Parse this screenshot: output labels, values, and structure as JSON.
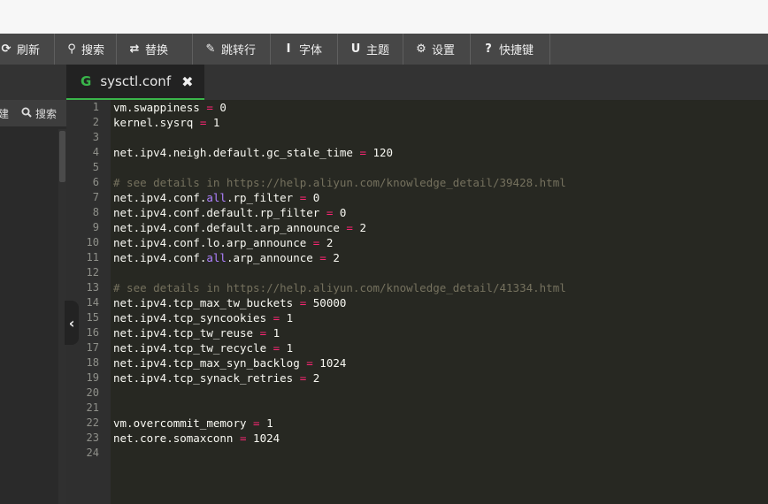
{
  "toolbar": {
    "items": [
      {
        "icon": "refresh-icon",
        "glyph": "⟳",
        "label": "刷新"
      },
      {
        "icon": "search-icon",
        "glyph": "⚲",
        "label": "搜索"
      },
      {
        "icon": "replace-icon",
        "glyph": "⇄",
        "label": "替换"
      },
      {
        "icon": "pin-icon",
        "glyph": "✎",
        "label": "跳转行"
      },
      {
        "icon": "font-icon",
        "glyph": "I",
        "label": "字体"
      },
      {
        "icon": "magnet-icon",
        "glyph": "U",
        "label": "主题"
      },
      {
        "icon": "gear-icon",
        "glyph": "⚙",
        "label": "设置"
      },
      {
        "icon": "help-icon",
        "glyph": "?",
        "label": "快捷键"
      }
    ]
  },
  "sidebar": {
    "partial_label": "建",
    "search_label": "搜索",
    "collapse_glyph": "‹"
  },
  "tab": {
    "icon": "G",
    "filename": "sysctl.conf",
    "close_glyph": "✖"
  },
  "editor": {
    "lines": [
      {
        "n": "1",
        "tokens": [
          {
            "t": "vm.swappiness ",
            "c": ""
          },
          {
            "t": "=",
            "c": "op"
          },
          {
            "t": " 0",
            "c": ""
          }
        ]
      },
      {
        "n": "2",
        "tokens": [
          {
            "t": "kernel.sysrq ",
            "c": ""
          },
          {
            "t": "=",
            "c": "op"
          },
          {
            "t": " 1",
            "c": ""
          }
        ]
      },
      {
        "n": "3",
        "tokens": []
      },
      {
        "n": "4",
        "tokens": [
          {
            "t": "net.ipv4.neigh.default.gc_stale_time ",
            "c": ""
          },
          {
            "t": "=",
            "c": "op"
          },
          {
            "t": " 120",
            "c": ""
          }
        ]
      },
      {
        "n": "5",
        "tokens": []
      },
      {
        "n": "6",
        "tokens": [
          {
            "t": "# see details in https://help.aliyun.com/knowledge_detail/39428.html",
            "c": "cmt"
          }
        ]
      },
      {
        "n": "7",
        "tokens": [
          {
            "t": "net.ipv4.conf.",
            "c": ""
          },
          {
            "t": "all",
            "c": "kw"
          },
          {
            "t": ".rp_filter ",
            "c": ""
          },
          {
            "t": "=",
            "c": "op"
          },
          {
            "t": " 0",
            "c": ""
          }
        ]
      },
      {
        "n": "8",
        "tokens": [
          {
            "t": "net.ipv4.conf.default.rp_filter ",
            "c": ""
          },
          {
            "t": "=",
            "c": "op"
          },
          {
            "t": " 0",
            "c": ""
          }
        ]
      },
      {
        "n": "9",
        "tokens": [
          {
            "t": "net.ipv4.conf.default.arp_announce ",
            "c": ""
          },
          {
            "t": "=",
            "c": "op"
          },
          {
            "t": " 2",
            "c": ""
          }
        ]
      },
      {
        "n": "10",
        "tokens": [
          {
            "t": "net.ipv4.conf.lo.arp_announce ",
            "c": ""
          },
          {
            "t": "=",
            "c": "op"
          },
          {
            "t": " 2",
            "c": ""
          }
        ]
      },
      {
        "n": "11",
        "tokens": [
          {
            "t": "net.ipv4.conf.",
            "c": ""
          },
          {
            "t": "all",
            "c": "kw"
          },
          {
            "t": ".arp_announce ",
            "c": ""
          },
          {
            "t": "=",
            "c": "op"
          },
          {
            "t": " 2",
            "c": ""
          }
        ]
      },
      {
        "n": "12",
        "tokens": []
      },
      {
        "n": "13",
        "tokens": [
          {
            "t": "# see details in https://help.aliyun.com/knowledge_detail/41334.html",
            "c": "cmt"
          }
        ]
      },
      {
        "n": "14",
        "tokens": [
          {
            "t": "net.ipv4.tcp_max_tw_buckets ",
            "c": ""
          },
          {
            "t": "=",
            "c": "op"
          },
          {
            "t": " 50000",
            "c": ""
          }
        ]
      },
      {
        "n": "15",
        "tokens": [
          {
            "t": "net.ipv4.tcp_syncookies ",
            "c": ""
          },
          {
            "t": "=",
            "c": "op"
          },
          {
            "t": " 1",
            "c": ""
          }
        ]
      },
      {
        "n": "16",
        "tokens": [
          {
            "t": "net.ipv4.tcp_tw_reuse ",
            "c": ""
          },
          {
            "t": "=",
            "c": "op"
          },
          {
            "t": " 1",
            "c": ""
          }
        ]
      },
      {
        "n": "17",
        "tokens": [
          {
            "t": "net.ipv4.tcp_tw_recycle ",
            "c": ""
          },
          {
            "t": "=",
            "c": "op"
          },
          {
            "t": " 1",
            "c": ""
          }
        ]
      },
      {
        "n": "18",
        "tokens": [
          {
            "t": "net.ipv4.tcp_max_syn_backlog ",
            "c": ""
          },
          {
            "t": "=",
            "c": "op"
          },
          {
            "t": " 1024",
            "c": ""
          }
        ]
      },
      {
        "n": "19",
        "tokens": [
          {
            "t": "net.ipv4.tcp_synack_retries ",
            "c": ""
          },
          {
            "t": "=",
            "c": "op"
          },
          {
            "t": " 2",
            "c": ""
          }
        ]
      },
      {
        "n": "20",
        "tokens": []
      },
      {
        "n": "21",
        "tokens": []
      },
      {
        "n": "22",
        "tokens": [
          {
            "t": "vm.overcommit_memory ",
            "c": ""
          },
          {
            "t": "=",
            "c": "op"
          },
          {
            "t": " 1",
            "c": ""
          }
        ]
      },
      {
        "n": "23",
        "tokens": [
          {
            "t": "net.core.somaxconn ",
            "c": ""
          },
          {
            "t": "=",
            "c": "op"
          },
          {
            "t": " 1024",
            "c": ""
          }
        ]
      },
      {
        "n": "24",
        "tokens": []
      }
    ]
  },
  "colors": {
    "accent": "#39b54a",
    "editor_bg": "#272822",
    "operator": "#f92672",
    "keyword": "#ae81ff",
    "comment": "#75715e"
  }
}
